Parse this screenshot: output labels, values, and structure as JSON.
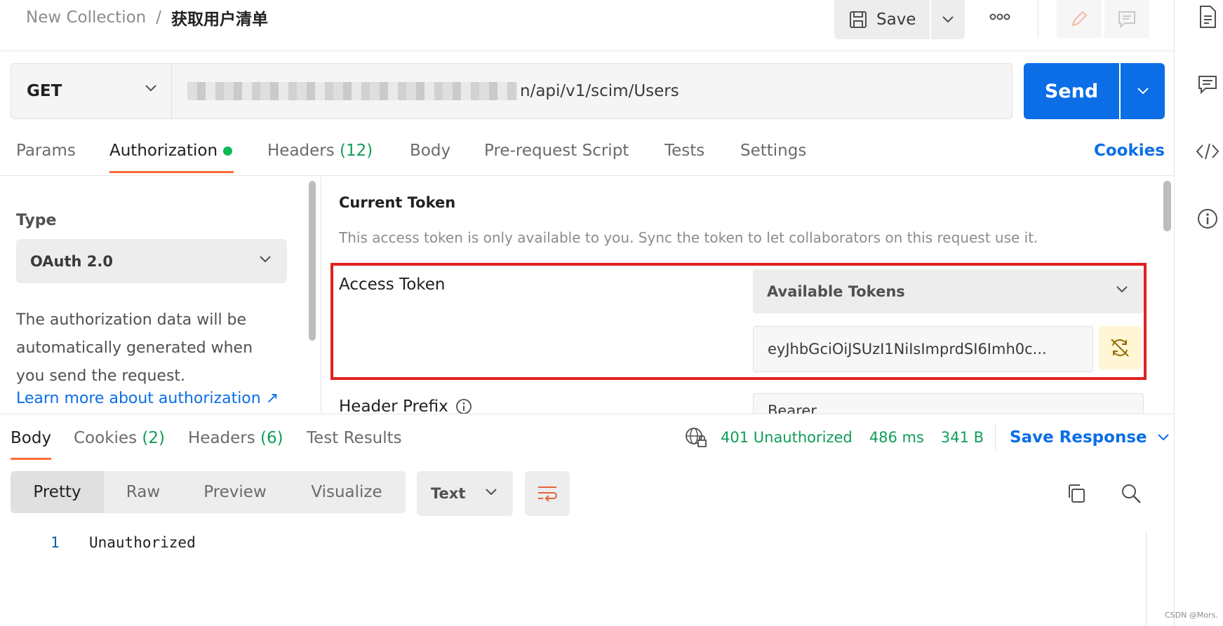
{
  "breadcrumb": {
    "collection": "New Collection",
    "separator": "/",
    "request_name": "获取用户清单"
  },
  "toolbar": {
    "save_label": "Save"
  },
  "request": {
    "method": "GET",
    "url_visible": "n/api/v1/scim/Users",
    "send_label": "Send"
  },
  "request_tabs": {
    "params": "Params",
    "authorization": "Authorization",
    "headers": "Headers",
    "headers_count": "(12)",
    "body": "Body",
    "prerequest": "Pre-request Script",
    "tests": "Tests",
    "settings": "Settings",
    "cookies_link": "Cookies"
  },
  "auth": {
    "type_label": "Type",
    "type_value": "OAuth 2.0",
    "description": "The authorization data will be automatically generated when you send the request.",
    "learn_more": "Learn more about authorization ↗",
    "current_token_title": "Current Token",
    "current_token_help": "This access token is only available to you. Sync the token to let collaborators on this request use it.",
    "access_token_label": "Access Token",
    "available_tokens": "Available Tokens",
    "token_value": "eyJhbGciOiJSUzI1NiIsImprdSI6Imh0c...",
    "header_prefix_label": "Header Prefix",
    "header_prefix_value": "Bearer"
  },
  "response": {
    "tabs": {
      "body": "Body",
      "cookies": "Cookies",
      "cookies_count": "(2)",
      "headers": "Headers",
      "headers_count": "(6)",
      "test_results": "Test Results"
    },
    "status": "401 Unauthorized",
    "time": "486 ms",
    "size": "341 B",
    "save_response": "Save Response",
    "view_modes": [
      "Pretty",
      "Raw",
      "Preview",
      "Visualize"
    ],
    "format": "Text",
    "lines": [
      {
        "number": "1",
        "text": "Unauthorized"
      }
    ]
  },
  "watermark": "CSDN @Mors.",
  "colors": {
    "brand_blue": "#0b6ee6",
    "accent_orange": "#ff6c37",
    "success_green": "#0f9d58",
    "highlight_red": "#e02020"
  }
}
